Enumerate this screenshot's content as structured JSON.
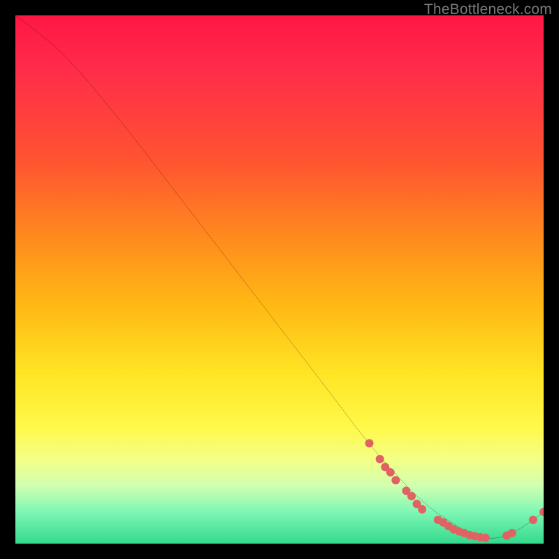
{
  "watermark": "TheBottleneck.com",
  "chart_data": {
    "type": "line",
    "title": "",
    "xlabel": "",
    "ylabel": "",
    "xlim": [
      0,
      100
    ],
    "ylim": [
      0,
      100
    ],
    "grid": false,
    "background_gradient": {
      "top": "#ff1744",
      "mid1": "#ff8a1e",
      "mid2": "#ffe525",
      "bottom": "#34d98d"
    },
    "series": [
      {
        "name": "curve",
        "x": [
          0,
          4,
          10,
          20,
          30,
          40,
          50,
          60,
          66,
          72,
          78,
          84,
          88,
          92,
          96,
          100
        ],
        "y": [
          100,
          97,
          92,
          80,
          67,
          54,
          41,
          28,
          20,
          13,
          7,
          3,
          1,
          1,
          3,
          6
        ],
        "color": "#000000"
      }
    ],
    "markers": [
      {
        "x": 67,
        "y": 19
      },
      {
        "x": 69,
        "y": 16
      },
      {
        "x": 70,
        "y": 14.5
      },
      {
        "x": 71,
        "y": 13.5
      },
      {
        "x": 72,
        "y": 12
      },
      {
        "x": 74,
        "y": 10
      },
      {
        "x": 75,
        "y": 9
      },
      {
        "x": 76,
        "y": 7.5
      },
      {
        "x": 77,
        "y": 6.5
      },
      {
        "x": 80,
        "y": 4.5
      },
      {
        "x": 81,
        "y": 4
      },
      {
        "x": 82,
        "y": 3.3
      },
      {
        "x": 83,
        "y": 2.7
      },
      {
        "x": 84,
        "y": 2.3
      },
      {
        "x": 85,
        "y": 2
      },
      {
        "x": 86,
        "y": 1.6
      },
      {
        "x": 87,
        "y": 1.4
      },
      {
        "x": 88,
        "y": 1.2
      },
      {
        "x": 89,
        "y": 1.1
      },
      {
        "x": 93,
        "y": 1.5
      },
      {
        "x": 94,
        "y": 2
      },
      {
        "x": 98,
        "y": 4.5
      },
      {
        "x": 100,
        "y": 6
      }
    ],
    "marker_color": "#e06363",
    "marker_radius": 6
  }
}
